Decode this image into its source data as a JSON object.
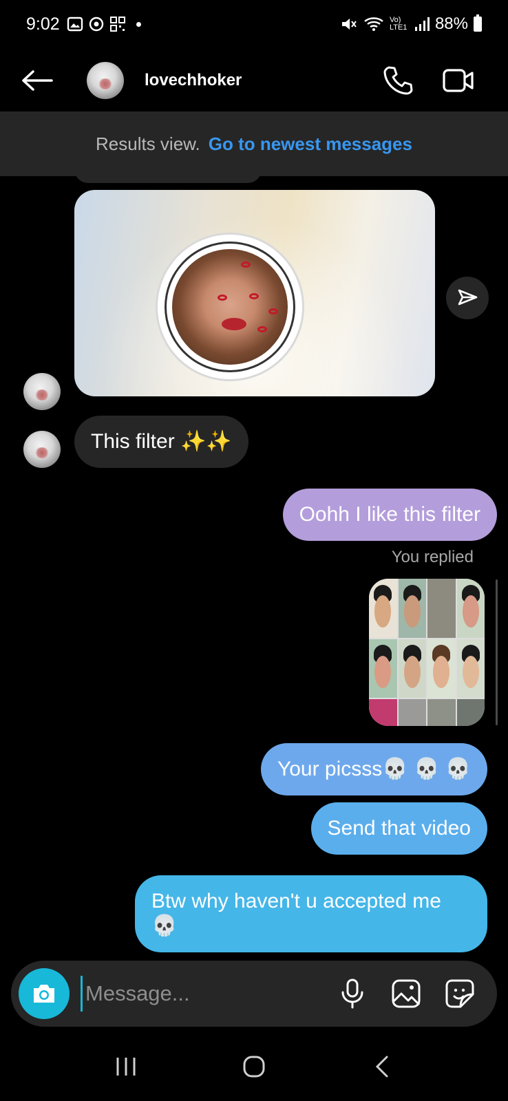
{
  "status_bar": {
    "time": "9:02",
    "network": "Vo) LTE1",
    "battery": "88%"
  },
  "header": {
    "username": "lovechhoker",
    "back_icon": "arrow-left-icon",
    "call_icon": "phone-icon",
    "video_icon": "video-camera-icon"
  },
  "banner": {
    "label": "Results view.",
    "link": "Go to newest messages"
  },
  "messages": {
    "incoming_1": "This filter ✨✨",
    "outgoing_1": "Oohh I like this filter",
    "replied_label": "You replied",
    "outgoing_2": "Your picsss💀 💀 💀",
    "outgoing_3": "Send that video",
    "outgoing_4_line1": "Btw why haven't u accepted me",
    "outgoing_4_line2": "💀"
  },
  "composer": {
    "placeholder": "Message..."
  },
  "colors": {
    "accent": "#3897f0",
    "camera": "#18b8d8",
    "bubble_in": "#262626",
    "bubble_purple": "#b39ddb",
    "bubble_blue_1": "#6ea8ec",
    "bubble_blue_2": "#5aaeec",
    "bubble_blue_3": "#45b6e8"
  }
}
